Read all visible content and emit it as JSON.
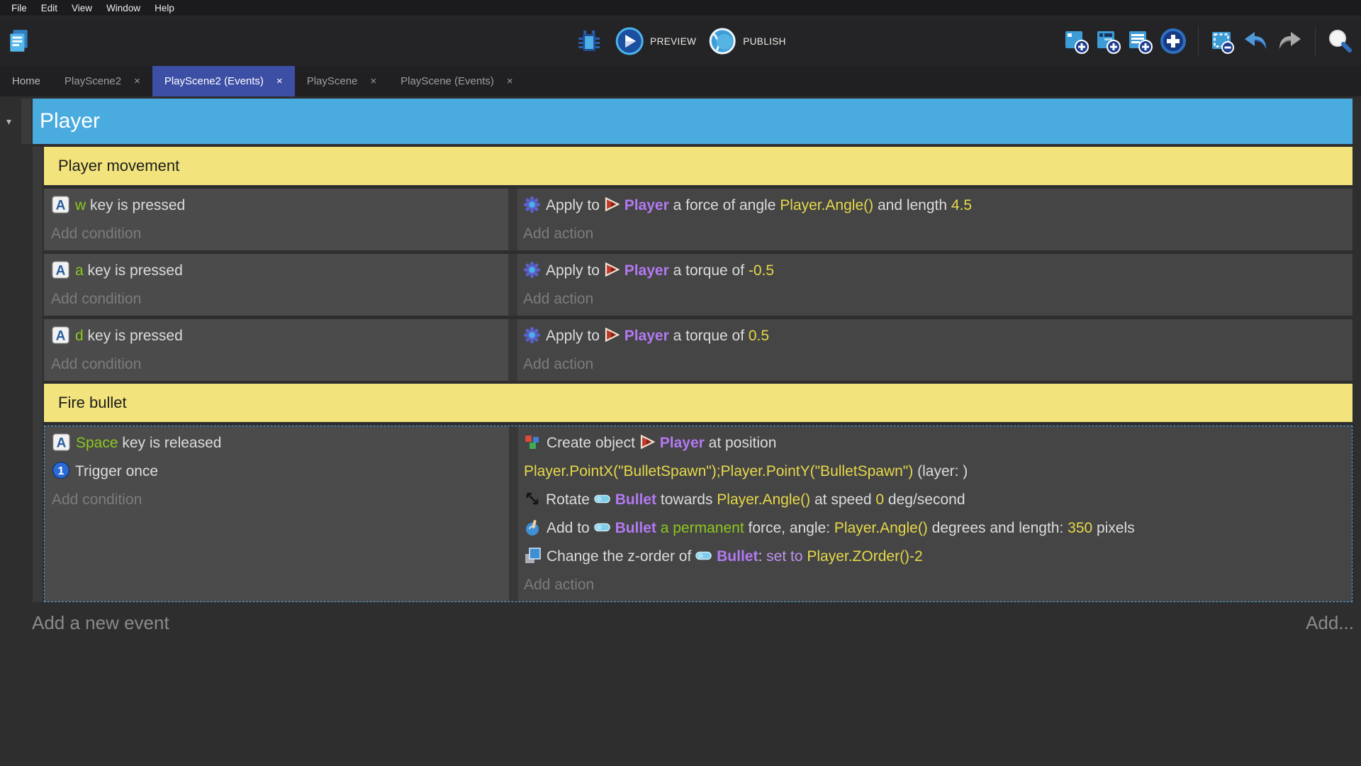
{
  "menu_bar": {
    "items": [
      "File",
      "Edit",
      "View",
      "Window",
      "Help"
    ]
  },
  "toolbar": {
    "left": [
      {
        "icon": "project-manager-icon"
      }
    ],
    "center": [
      {
        "icon": "debug-icon",
        "label": ""
      },
      {
        "icon": "preview-icon",
        "label": "PREVIEW"
      },
      {
        "icon": "publish-icon",
        "label": "PUBLISH"
      }
    ],
    "right": [
      {
        "icon": "add-event-icon"
      },
      {
        "icon": "add-subevent-icon"
      },
      {
        "icon": "add-comment-icon"
      },
      {
        "icon": "add-circle-icon"
      },
      {
        "separator": true
      },
      {
        "icon": "select-events-icon"
      },
      {
        "icon": "undo-icon"
      },
      {
        "icon": "redo-icon"
      },
      {
        "separator": true
      },
      {
        "icon": "search-icon"
      }
    ]
  },
  "tabs": [
    {
      "label": "Home",
      "closable": false,
      "active": false
    },
    {
      "label": "PlayScene2",
      "closable": true,
      "active": false
    },
    {
      "label": "PlayScene2 (Events)",
      "closable": true,
      "active": true
    },
    {
      "label": "PlayScene",
      "closable": true,
      "active": false
    },
    {
      "label": "PlayScene (Events)",
      "closable": true,
      "active": false
    }
  ],
  "events_sheet": {
    "group_title": "Player",
    "collapse_arrow": "▾",
    "add_condition_label": "Add condition",
    "add_action_label": "Add action",
    "events": [
      {
        "type": "comment",
        "text": "Player movement"
      },
      {
        "type": "event",
        "selected": false,
        "conditions": [
          {
            "icon": "keyboard-icon",
            "segments": [
              {
                "t": "w",
                "c": "green"
              },
              {
                "t": " key is pressed"
              }
            ]
          }
        ],
        "actions": [
          {
            "icon": "physics-icon",
            "segments": [
              {
                "t": "Apply to "
              },
              {
                "i": "player-object-icon"
              },
              {
                "t": "Player",
                "c": "object"
              },
              {
                "t": " a force of angle "
              },
              {
                "t": "Player.Angle()",
                "c": "expr"
              },
              {
                "t": " and length "
              },
              {
                "t": "4.5",
                "c": "expr"
              }
            ]
          }
        ]
      },
      {
        "type": "event",
        "selected": false,
        "conditions": [
          {
            "icon": "keyboard-icon",
            "segments": [
              {
                "t": "a",
                "c": "green"
              },
              {
                "t": " key is pressed"
              }
            ]
          }
        ],
        "actions": [
          {
            "icon": "physics-icon",
            "segments": [
              {
                "t": "Apply to "
              },
              {
                "i": "player-object-icon"
              },
              {
                "t": "Player",
                "c": "object"
              },
              {
                "t": " a torque of "
              },
              {
                "t": "-0.5",
                "c": "expr"
              }
            ]
          }
        ]
      },
      {
        "type": "event",
        "selected": false,
        "conditions": [
          {
            "icon": "keyboard-icon",
            "segments": [
              {
                "t": "d",
                "c": "green"
              },
              {
                "t": " key is pressed"
              }
            ]
          }
        ],
        "actions": [
          {
            "icon": "physics-icon",
            "segments": [
              {
                "t": "Apply to "
              },
              {
                "i": "player-object-icon"
              },
              {
                "t": "Player",
                "c": "object"
              },
              {
                "t": " a torque of "
              },
              {
                "t": "0.5",
                "c": "expr"
              }
            ]
          }
        ]
      },
      {
        "type": "comment",
        "text": "Fire bullet"
      },
      {
        "type": "event",
        "selected": true,
        "conditions": [
          {
            "icon": "keyboard-icon",
            "segments": [
              {
                "t": "Space",
                "c": "green"
              },
              {
                "t": " key is released"
              }
            ]
          },
          {
            "icon": "trigger-once-icon",
            "segments": [
              {
                "t": "Trigger once"
              }
            ]
          }
        ],
        "actions": [
          {
            "icon": "create-object-icon",
            "segments": [
              {
                "t": "Create object "
              },
              {
                "i": "player-object-icon"
              },
              {
                "t": "Player",
                "c": "object"
              },
              {
                "t": " at position "
              },
              {
                "br": true
              },
              {
                "t": "Player.PointX(\"BulletSpawn\");Player.PointY(\"BulletSpawn\")",
                "c": "expr"
              },
              {
                "t": " (layer: )"
              }
            ]
          },
          {
            "icon": "rotate-icon",
            "segments": [
              {
                "t": "Rotate "
              },
              {
                "i": "bullet-object-icon"
              },
              {
                "t": "Bullet",
                "c": "object"
              },
              {
                "t": " towards "
              },
              {
                "t": "Player.Angle()",
                "c": "expr"
              },
              {
                "t": " at speed "
              },
              {
                "t": "0",
                "c": "expr"
              },
              {
                "t": " deg/second"
              }
            ]
          },
          {
            "icon": "force-icon",
            "segments": [
              {
                "t": "Add to "
              },
              {
                "i": "bullet-object-icon"
              },
              {
                "t": "Bullet",
                "c": "object"
              },
              {
                "t": " a permanent",
                "c": "green"
              },
              {
                "t": " force, angle: "
              },
              {
                "t": "Player.Angle()",
                "c": "expr"
              },
              {
                "t": " degrees and length: "
              },
              {
                "t": "350",
                "c": "expr"
              },
              {
                "t": " pixels"
              }
            ]
          },
          {
            "icon": "zorder-icon",
            "segments": [
              {
                "t": "Change the z-order of "
              },
              {
                "i": "bullet-object-icon"
              },
              {
                "t": "Bullet",
                "c": "object"
              },
              {
                "t": ": "
              },
              {
                "t": "set to",
                "c": "violet"
              },
              {
                "t": " "
              },
              {
                "t": "Player.ZOrder()-2",
                "c": "expr"
              }
            ]
          }
        ]
      }
    ]
  },
  "footer": {
    "add_new_event": "Add a new event",
    "add_more": "Add..."
  },
  "colors": {
    "group_header_blue": "#4aabdf",
    "comment_yellow": "#f2e37c",
    "active_tab_indigo": "#3d4ea5",
    "object_purple": "#b279f2",
    "expression_yellow": "#e6d84a",
    "key_green": "#8bc71f",
    "selection_border_blue": "#4fa7e8"
  }
}
